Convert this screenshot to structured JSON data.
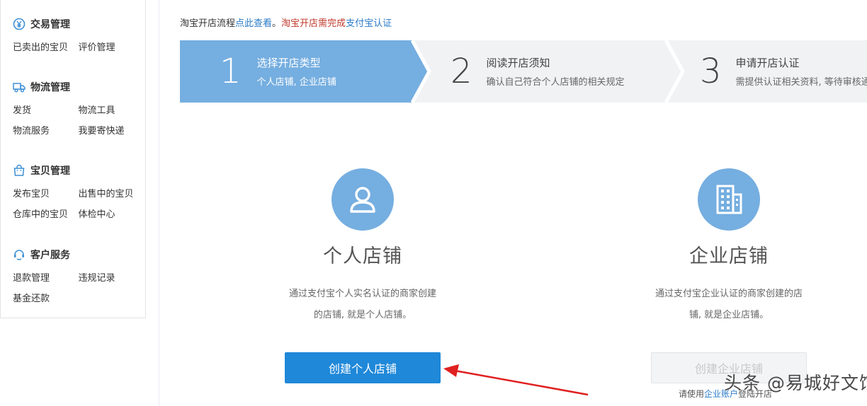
{
  "sidebar": {
    "sections": [
      {
        "title": "交易管理",
        "icon": "yen-circle-icon",
        "rows": [
          [
            "已卖出的宝贝",
            "评价管理"
          ]
        ]
      },
      {
        "title": "物流管理",
        "icon": "truck-icon",
        "rows": [
          [
            "发货",
            "物流工具"
          ],
          [
            "物流服务",
            "我要寄快递"
          ]
        ]
      },
      {
        "title": "宝贝管理",
        "icon": "shopping-bag-icon",
        "rows": [
          [
            "发布宝贝",
            "出售中的宝贝"
          ],
          [
            "仓库中的宝贝",
            "体检中心"
          ]
        ]
      },
      {
        "title": "客户服务",
        "icon": "customer-service-icon",
        "rows": [
          [
            "退款管理",
            "违规记录"
          ],
          [
            "基金还款",
            ""
          ]
        ]
      }
    ]
  },
  "notice": {
    "prefix": "淘宝开店流程",
    "link": "点此查看",
    "sep": "。",
    "warning": "淘宝开店需完成",
    "alipay_link": "支付宝认证"
  },
  "steps": [
    {
      "number": "1",
      "title": "选择开店类型",
      "desc": "个人店铺, 企业店铺",
      "active": true
    },
    {
      "number": "2",
      "title": "阅读开店须知",
      "desc": "确认自己符合个人店铺的相关规定",
      "active": false
    },
    {
      "number": "3",
      "title": "申请开店认证",
      "desc": "需提供认证相关资料, 等待审核通",
      "active": false
    }
  ],
  "cards": {
    "personal": {
      "icon": "user-icon",
      "title": "个人店铺",
      "desc_line1": "通过支付宝个人实名认证的商家创建",
      "desc_line2": "的店铺, 就是个人店铺。",
      "button": "创建个人店铺"
    },
    "enterprise": {
      "icon": "building-icon",
      "title": "企业店铺",
      "desc_line1": "通过支付宝企业认证的商家创建的店",
      "desc_line2": "铺, 就是企业店铺。",
      "button": "创建企业店铺",
      "hint_prefix": "请使用",
      "hint_link": "企业账户",
      "hint_suffix": "登陆开店"
    }
  },
  "watermark": "头条 @易城好文馆",
  "colors": {
    "active_step": "#75aee0",
    "inactive_step": "#f1f2f4",
    "primary_button": "#1f88d9",
    "link": "#2a7bc8",
    "warning": "#c0392b",
    "arrow": "#e02020"
  }
}
